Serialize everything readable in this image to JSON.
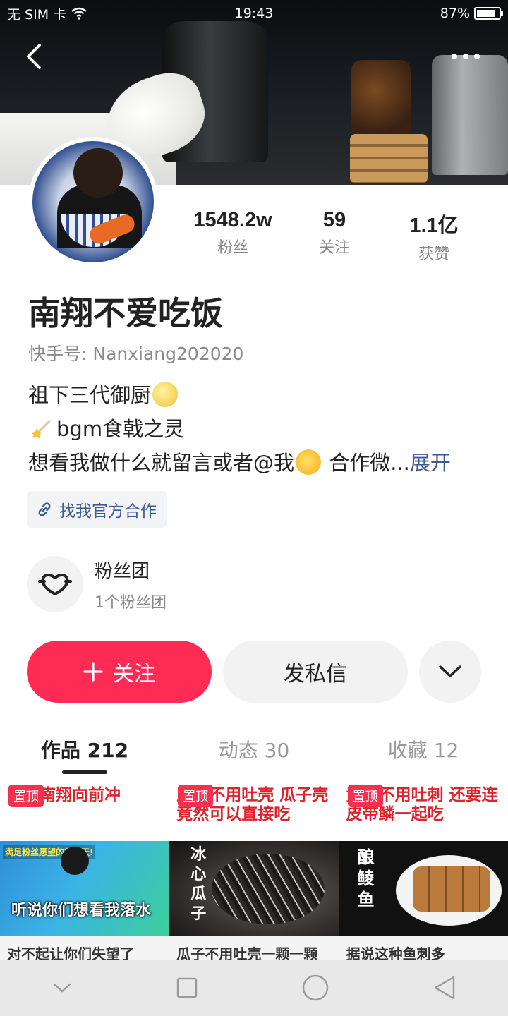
{
  "status_bar": {
    "carrier": "无 SIM 卡",
    "time": "19:43",
    "battery": "87%",
    "battery_level": 0.87
  },
  "profile": {
    "stats": [
      {
        "value": "1548.2w",
        "label": "粉丝"
      },
      {
        "value": "59",
        "label": "关注"
      },
      {
        "value": "1.1亿",
        "label": "获赞"
      }
    ],
    "name": "南翔不爱吃饭",
    "user_id": "快手号: Nanxiang202020",
    "bio": {
      "line1": "祖下三代御厨",
      "line2": "bgm食戟之灵",
      "line3": "想看我做什么就留言或者@我",
      "line3_tail": " 合作微...",
      "expand": "展开"
    },
    "link_chip": "找我官方合作"
  },
  "fan_club": {
    "title": "粉丝团",
    "subtitle": "1个粉丝团"
  },
  "actions": {
    "follow": "关注",
    "message": "发私信"
  },
  "tabs": [
    {
      "label": "作品 212"
    },
    {
      "label": "动态 30"
    },
    {
      "label": "收藏 12"
    }
  ],
  "videos": [
    {
      "pin": "置顶",
      "title": "南翔南翔向前冲",
      "img_top_note": "满足粉丝愿望的第二天!",
      "img_caption": "听说你们想看我落水",
      "footer": "对不起让你们失望了"
    },
    {
      "pin": "置顶",
      "title": "瓜子不用吐壳 瓜子壳竟然可以直接吃",
      "img_caption": "冰心瓜子",
      "footer": "瓜子不用吐壳一颗一颗"
    },
    {
      "pin": "置顶",
      "title": "竟然不用吐刺 还要连皮带鳞一起吃",
      "img_caption": "酿鲮鱼",
      "footer": "据说这种鱼刺多"
    }
  ]
}
